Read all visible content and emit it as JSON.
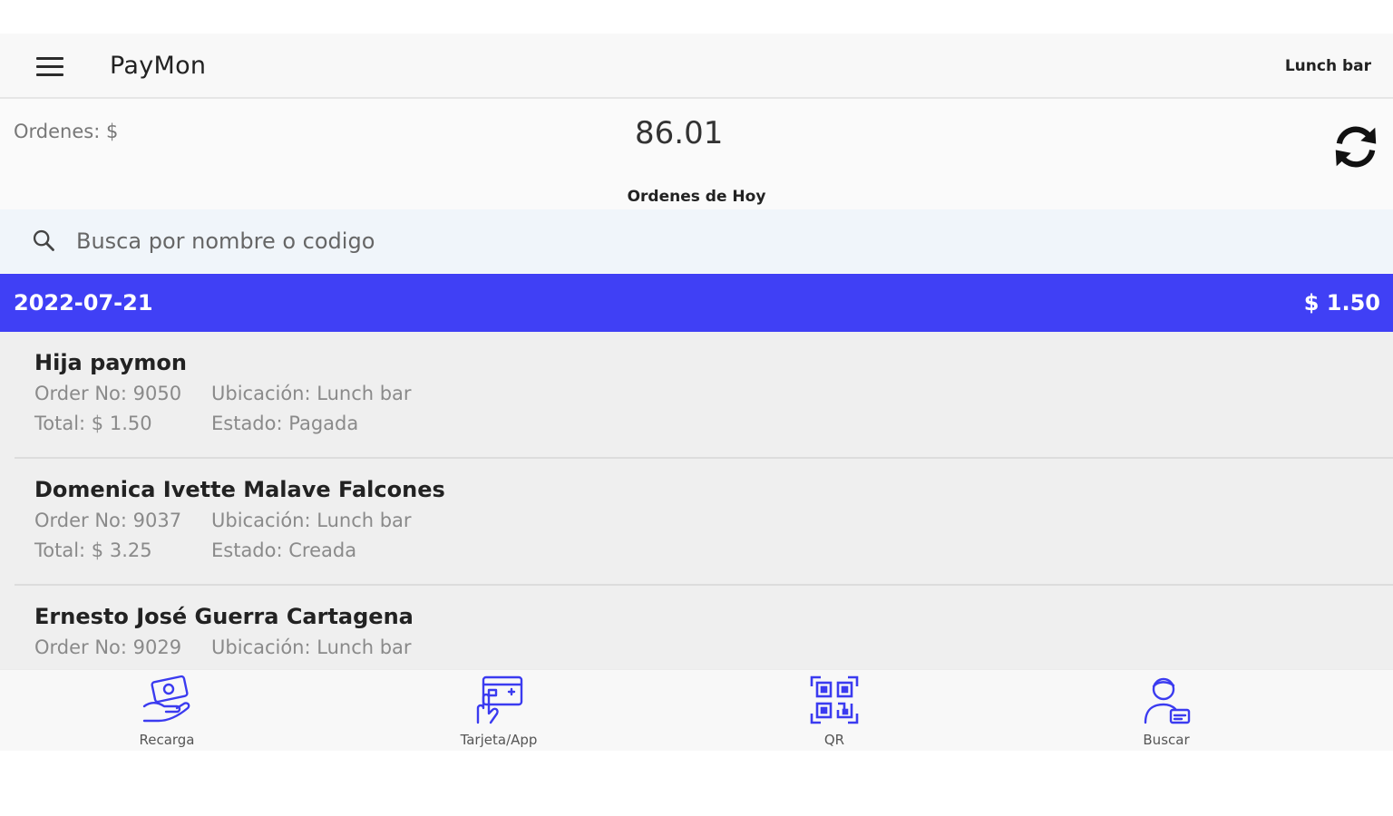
{
  "appbar": {
    "title": "PayMon",
    "location": "Lunch bar"
  },
  "summary": {
    "orders_label": "Ordenes: $",
    "orders_total": "86.01",
    "today_label": "Ordenes de Hoy"
  },
  "search": {
    "placeholder": "Busca por nombre o codigo",
    "value": ""
  },
  "date_group": {
    "date": "2022-07-21",
    "total": "$ 1.50"
  },
  "orders": [
    {
      "name": "Hija paymon",
      "order_no": "Order No:  9050",
      "location": "Ubicación: Lunch bar",
      "total": "Total: $ 1.50",
      "status": "Estado: Pagada"
    },
    {
      "name": "Domenica Ivette Malave Falcones",
      "order_no": "Order No:  9037",
      "location": "Ubicación: Lunch bar",
      "total": "Total: $ 3.25",
      "status": "Estado: Creada"
    },
    {
      "name": "Ernesto José Guerra Cartagena",
      "order_no": "Order No:  9029",
      "location": "Ubicación: Lunch bar",
      "total": "",
      "status": ""
    }
  ],
  "bottom_nav": [
    {
      "label": "Recarga",
      "icon": "hand-money-icon"
    },
    {
      "label": "Tarjeta/App",
      "icon": "card-tap-icon"
    },
    {
      "label": "QR",
      "icon": "qr-code-icon"
    },
    {
      "label": "Buscar",
      "icon": "user-search-icon"
    }
  ],
  "colors": {
    "accent": "#4040f5",
    "nav_icon": "#3b3bf0"
  }
}
